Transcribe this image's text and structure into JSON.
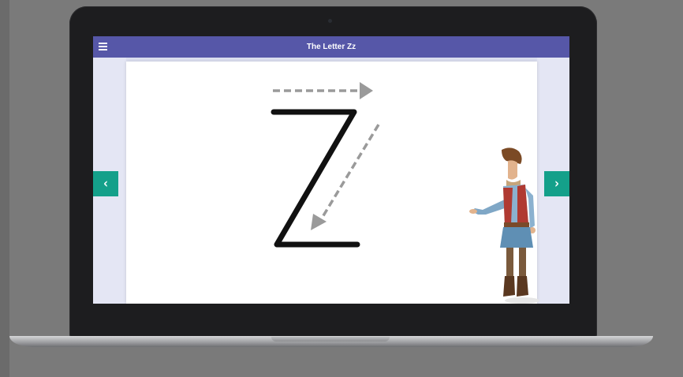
{
  "app": {
    "title": "The Letter Zz"
  },
  "toolbar": {
    "menu_icon": "hamburger-menu-icon"
  },
  "navigation": {
    "prev_icon": "chevron-left-icon",
    "prev_glyph": "‹",
    "next_icon": "chevron-right-icon",
    "next_glyph": "›"
  },
  "colors": {
    "app_bar": "#5657a8",
    "nav_button": "#14a08a",
    "letter_stroke": "#111111",
    "guide_arrow": "#9a9a9a",
    "side_panels": "#e4e6f4"
  }
}
